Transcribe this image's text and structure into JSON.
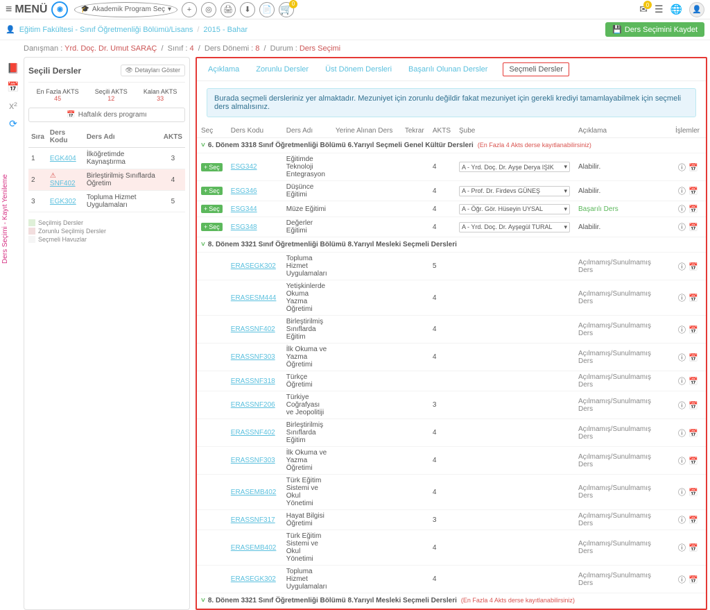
{
  "topbar": {
    "menu": "MENÜ",
    "program_label": "Akademik Program Seç",
    "notif_count": "0",
    "msg_count": "0"
  },
  "breadcrumb": {
    "faculty": "Eğitim Fakültesi - Sınıf Öğretmenliği Bölümü/Lisans",
    "term": "2015 - Bahar",
    "save_btn": "Ders Seçimini Kaydet"
  },
  "advisor": {
    "advisor_label": "Danışman :",
    "advisor_val": "Yrd. Doç. Dr. Umut SARAÇ",
    "class_label": "Sınıf :",
    "class_val": "4",
    "period_label": "Ders Dönemi :",
    "period_val": "8",
    "state_label": "Durum :",
    "state_val": "Ders Seçimi"
  },
  "left_panel": {
    "title": "Seçili Dersler",
    "detail_btn": "Detayları Göster",
    "enfazla_label": "En Fazla AKTS",
    "enfazla_val": "45",
    "secili_label": "Seçili AKTS",
    "secili_val": "12",
    "kalan_label": "Kalan AKTS",
    "kalan_val": "33",
    "schedule_btn": "Haftalık ders programı",
    "th_sira": "Sıra",
    "th_kod": "Ders Kodu",
    "th_ad": "Ders Adı",
    "th_akts": "AKTS",
    "rows": [
      {
        "n": "1",
        "code": "EGK404",
        "name": "İlköğretimde Kaynaştırma",
        "akts": "3",
        "warn": false
      },
      {
        "n": "2",
        "code": "SNF402",
        "name": "Birleştirilmiş Sınıflarda Öğretim",
        "akts": "4",
        "warn": true
      },
      {
        "n": "3",
        "code": "EGK302",
        "name": "Topluma Hizmet Uygulamaları",
        "akts": "5",
        "warn": false
      }
    ],
    "legend_1": "Seçilmiş Dersler",
    "legend_2": "Zorunlu Seçilmiş Dersler",
    "legend_3": "Seçmeli Havuzlar"
  },
  "tabs": {
    "t1": "Açıklama",
    "t2": "Zorunlu Dersler",
    "t3": "Üst Dönem Dersleri",
    "t4": "Başarılı Olunan Dersler",
    "t5": "Seçmeli Dersler"
  },
  "info_text": "Burada seçmeli dersleriniz yer almaktadır. Mezuniyet için zorunlu değildir fakat mezuniyet için gerekli krediyi tamamlayabilmek için seçmeli ders almalısınız.",
  "main_th": {
    "sec": "Seç",
    "kod": "Ders Kodu",
    "ad": "Ders Adı",
    "yerine": "Yerine Alınan Ders",
    "tekrar": "Tekrar",
    "akts": "AKTS",
    "sube": "Şube",
    "aciklama": "Açıklama",
    "islem": "İşlemler"
  },
  "group1": {
    "title": "6. Dönem 3318 Sınıf Öğretmenliği Bölümü 6.Yarıyıl Seçmeli Genel Kültür Dersleri",
    "hint": "(En Fazla 4 Akts derse kayıtlanabilirsiniz)",
    "rows": [
      {
        "sec": "Seç",
        "code": "ESG342",
        "name": "Eğitimde Teknoloji Entegrasyon",
        "akts": "4",
        "sube": "A - Yrd. Doç. Dr. Ayşe Derya IŞIK",
        "note": "Alabilir."
      },
      {
        "sec": "Seç",
        "code": "ESG346",
        "name": "Düşünce Eğitimi",
        "akts": "4",
        "sube": "A - Prof. Dr. Firdevs GÜNEŞ",
        "note": "Alabilir."
      },
      {
        "sec": "Seç",
        "code": "ESG344",
        "name": "Müze Eğitimi",
        "akts": "4",
        "sube": "A - Öğr. Gör. Hüseyin UYSAL",
        "note": "Başarılı Ders"
      },
      {
        "sec": "Seç",
        "code": "ESG348",
        "name": "Değerler Eğitimi",
        "akts": "4",
        "sube": "A - Yrd. Doç. Dr. Ayşegül TURAL",
        "note": "Alabilir."
      }
    ]
  },
  "group2": {
    "title": "8. Dönem 3321 Sınıf Öğretmenliği Bölümü 8.Yarıyıl Mesleki Seçmeli Dersleri",
    "rows": [
      {
        "code": "ERASEGK302",
        "name": "Topluma Hizmet Uygulamaları",
        "akts": "5",
        "note": "Açılmamış/Sunulmamış Ders"
      },
      {
        "code": "ERASESM444",
        "name": "Yetişkinlerde Okuma Yazma Öğretimi",
        "akts": "4",
        "note": "Açılmamış/Sunulmamış Ders"
      },
      {
        "code": "ERASSNF402",
        "name": "Birleştirilmiş Sınıflarda Eğitim",
        "akts": "4",
        "note": "Açılmamış/Sunulmamış Ders"
      },
      {
        "code": "ERASSNF303",
        "name": "İlk Okuma ve Yazma Öğretimi",
        "akts": "4",
        "note": "Açılmamış/Sunulmamış Ders"
      },
      {
        "code": "ERASSNF318",
        "name": "Türkçe Öğretimi",
        "akts": "",
        "note": "Açılmamış/Sunulmamış Ders"
      },
      {
        "code": "ERASSNF206",
        "name": "Türkiye Coğrafyası ve Jeopolitiji",
        "akts": "3",
        "note": "Açılmamış/Sunulmamış Ders"
      },
      {
        "code": "ERASSNF402",
        "name": "Birleştirilmiş Sınıflarda Eğitim",
        "akts": "4",
        "note": "Açılmamış/Sunulmamış Ders"
      },
      {
        "code": "ERASSNF303",
        "name": "İlk Okuma ve Yazma Öğretimi",
        "akts": "4",
        "note": "Açılmamış/Sunulmamış Ders"
      },
      {
        "code": "ERASEMB402",
        "name": "Türk Eğitim Sistemi ve Okul Yönetimi",
        "akts": "4",
        "note": "Açılmamış/Sunulmamış Ders"
      },
      {
        "code": "ERASSNF317",
        "name": "Hayat Bilgisi Öğretimi",
        "akts": "3",
        "note": "Açılmamış/Sunulmamış Ders"
      },
      {
        "code": "ERASEMB402",
        "name": "Türk Eğitim Sistemi ve Okul Yönetimi",
        "akts": "4",
        "note": "Açılmamış/Sunulmamış Ders"
      },
      {
        "code": "ERASEGK302",
        "name": "Topluma Hizmet Uygulamaları",
        "akts": "4",
        "note": "Açılmamış/Sunulmamış Ders"
      }
    ]
  },
  "group3": {
    "title": "8. Dönem 3321 Sınıf Öğretmenliği Bölümü 8.Yarıyıl Mesleki Seçmeli Dersleri",
    "hint": "(En Fazla 4 Akts derse kayıtlanabilirsiniz)"
  }
}
